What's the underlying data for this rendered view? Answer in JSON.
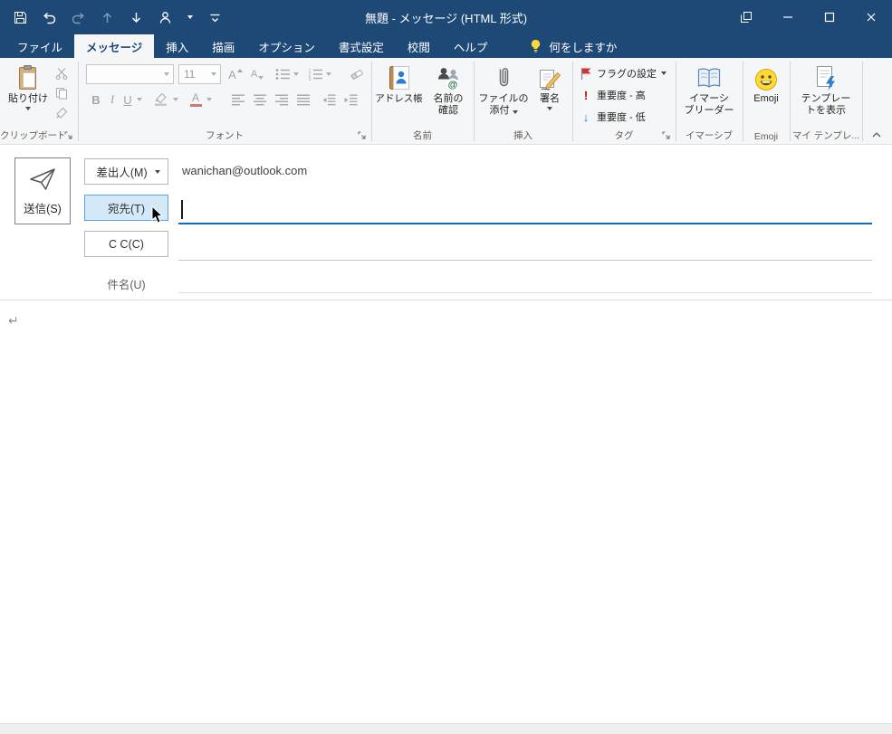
{
  "window": {
    "title": "無題 - メッセージ (HTML 形式)"
  },
  "tabs": [
    {
      "label": "ファイル",
      "active": false
    },
    {
      "label": "メッセージ",
      "active": true
    },
    {
      "label": "挿入",
      "active": false
    },
    {
      "label": "描画",
      "active": false
    },
    {
      "label": "オプション",
      "active": false
    },
    {
      "label": "書式設定",
      "active": false
    },
    {
      "label": "校閲",
      "active": false
    },
    {
      "label": "ヘルプ",
      "active": false
    }
  ],
  "tell_me": "何をしますか",
  "ribbon": {
    "clipboard": {
      "group": "クリップボード",
      "paste": "貼り付け"
    },
    "font": {
      "group": "フォント",
      "name_value": "",
      "size_value": "11",
      "bold": "B",
      "italic": "I",
      "underline": "U",
      "grow": "A",
      "shrink": "A"
    },
    "names": {
      "group": "名前",
      "address_book": "アドレス帳",
      "check_names": [
        "名前の",
        "確認"
      ]
    },
    "include": {
      "group": "挿入",
      "attach": [
        "ファイルの",
        "添付"
      ],
      "signature": "署名"
    },
    "tags": {
      "group": "タグ",
      "flag": "フラグの設定",
      "high": "重要度 - 高",
      "low": "重要度 - 低"
    },
    "immersive": {
      "group": "イマーシブ",
      "reader": [
        "イマーシ",
        "ブリーダー"
      ]
    },
    "emoji": {
      "group": "Emoji",
      "label": "Emoji"
    },
    "templates": {
      "group": "マイ テンプレ...",
      "show": [
        "テンプレー",
        "トを表示"
      ]
    }
  },
  "compose": {
    "send": "送信(S)",
    "from_label": "差出人(M)",
    "from_value": "wanichan@outlook.com",
    "to_label": "宛先(T)",
    "to_value": "",
    "cc_label": "C C(C)",
    "cc_value": "",
    "subject_label": "件名(U)",
    "subject_value": ""
  },
  "body": {
    "paragraph_mark": "↵"
  },
  "icons": {
    "importance_high": "!",
    "importance_low": "↓",
    "cut": "✂",
    "tell_me": "lightbulb"
  },
  "colors": {
    "titlebar_blue": "#1e4976",
    "ribbon_bg": "#f5f6f7",
    "accent_blue": "#0f6cbd",
    "focused_field_bg": "#d3e9f8",
    "focused_field_border": "#5ea4dc",
    "flag_red": "#d13438",
    "importance_high_red": "#c00000",
    "importance_low_blue": "#2b7cd3",
    "emoji_yellow": "#ffd83b",
    "disabled_gray": "#a6a6a6"
  }
}
